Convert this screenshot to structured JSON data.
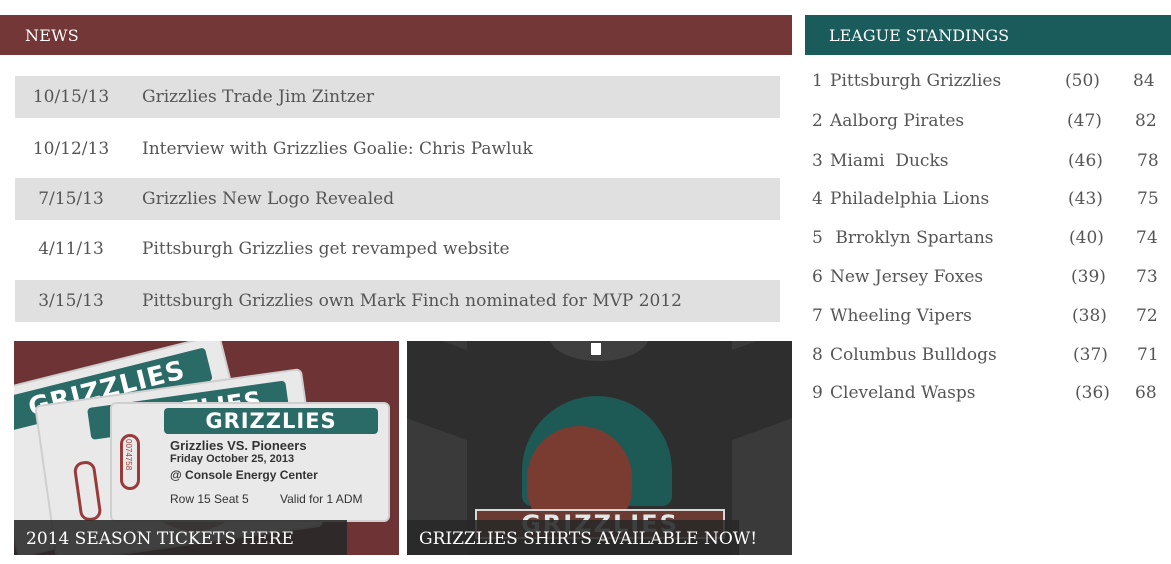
{
  "news": {
    "heading": "NEWS",
    "items": [
      {
        "date": "10/15/13",
        "title": "Grizzlies Trade Jim Zintzer"
      },
      {
        "date": "10/12/13",
        "title": "Interview with Grizzlies Goalie: Chris Pawluk"
      },
      {
        "date": "7/15/13",
        "title": "Grizzlies New Logo Revealed"
      },
      {
        "date": "4/11/13",
        "title": "Pittsburgh Grizzlies get revamped website"
      },
      {
        "date": "3/15/13",
        "title": "Pittsburgh Grizzlies own Mark Finch nominated for MVP 2012"
      }
    ]
  },
  "promos": {
    "tickets": {
      "caption": "2014 SEASON TICKETS HERE",
      "ticket_brand": "GRIZZLIES",
      "matchup": "Grizzlies VS. Pioneers",
      "game_date": "Friday October 25, 2013",
      "venue": "@ Console Energy Center",
      "seat": "Row 15 Seat 5",
      "admission": "Valid for 1 ADM",
      "serial": "0074758"
    },
    "shirts": {
      "caption": "GRIZZLIES SHIRTS AVAILABLE NOW!",
      "shirt_text": "GRIZZLIES"
    }
  },
  "standings": {
    "heading": "LEAGUE STANDINGS",
    "rows": [
      {
        "rank": "1",
        "team": "Pittsburgh Grizzlies",
        "record": "(50)",
        "points": "84"
      },
      {
        "rank": "2",
        "team": "Aalborg Pirates",
        "record": "(47)",
        "points": "82"
      },
      {
        "rank": "3",
        "team": "Miami  Ducks",
        "record": "(46)",
        "points": "78"
      },
      {
        "rank": "4",
        "team": "Philadelphia Lions",
        "record": "(43)",
        "points": "75"
      },
      {
        "rank": "5",
        "team": " Brroklyn Spartans",
        "record": "(40)",
        "points": "74"
      },
      {
        "rank": "6",
        "team": "New Jersey Foxes",
        "record": "(39)",
        "points": "73"
      },
      {
        "rank": "7",
        "team": "Wheeling Vipers",
        "record": "(38)",
        "points": "72"
      },
      {
        "rank": "8",
        "team": "Columbus Bulldogs",
        "record": "(37)",
        "points": "71"
      },
      {
        "rank": "9",
        "team": "Cleveland Wasps",
        "record": "(36)",
        "points": "68"
      }
    ]
  },
  "colors": {
    "news_header": "#733737",
    "standings_header": "#1a5c5c",
    "row_shade": "#e0e0e0"
  }
}
